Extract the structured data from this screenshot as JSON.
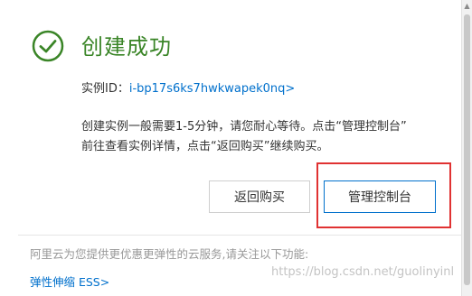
{
  "header": {
    "title": "创建成功"
  },
  "instance": {
    "label": "实例ID：",
    "id_link": "i-bp17s6ks7hwkwapek0nq>"
  },
  "description": {
    "line1": "创建实例一般需要1-5分钟，请您耐心等待。点击“管理控制台”",
    "line2": "前往查看实例详情，点击“返回购买”继续购买。"
  },
  "buttons": {
    "back_label": "返回购买",
    "console_label": "管理控制台"
  },
  "promo": {
    "text": "阿里云为您提供更优惠更弹性的云服务,请关注以下功能:",
    "ess_link": "弹性伸缩 ESS>"
  },
  "watermark": "https://blog.csdn.net/guolinyinl",
  "colors": {
    "success_green": "#3a8527",
    "link_blue": "#0070cc",
    "highlight_red": "#e03232"
  }
}
